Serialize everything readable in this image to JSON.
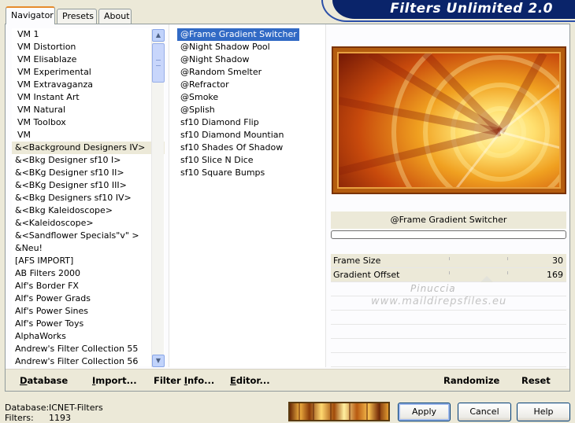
{
  "window": {
    "title": "Filters Unlimited 2.0"
  },
  "tabs": [
    {
      "label": "Navigator",
      "active": true
    },
    {
      "label": "Presets",
      "active": false
    },
    {
      "label": "About",
      "active": false
    }
  ],
  "categories": {
    "items": [
      "VM 1",
      "VM Distortion",
      "VM Elisablaze",
      "VM Experimental",
      "VM Extravaganza",
      "VM Instant Art",
      "VM Natural",
      "VM Toolbox",
      "VM",
      "&<Background Designers IV>",
      "&<Bkg Designer sf10 I>",
      "&<BKg Designer sf10 II>",
      "&<BKg Designer sf10 III>",
      "&<Bkg Designers sf10 IV>",
      "&<Bkg Kaleidoscope>",
      "&<Kaleidoscope>",
      "&<Sandflower Specials\"v\" >",
      "&Neu!",
      "[AFS IMPORT]",
      "AB Filters 2000",
      "Alf's Border FX",
      "Alf's Power Grads",
      "Alf's Power Sines",
      "Alf's Power Toys",
      "AlphaWorks",
      "Andrew's Filter Collection 55",
      "Andrew's Filter Collection 56"
    ],
    "selected_index": 9
  },
  "filters": {
    "items": [
      "@Frame Gradient Switcher",
      "@Night Shadow Pool",
      "@Night Shadow",
      "@Random Smelter",
      "@Refractor",
      "@Smoke",
      "@Splish",
      "sf10 Diamond Flip",
      "sf10 Diamond Mountian",
      "sf10 Shades Of Shadow",
      "sf10 Slice N Dice",
      "sf10 Square Bumps"
    ],
    "selected_index": 0
  },
  "preview": {
    "filter_name": "@Frame Gradient Switcher",
    "progress": 0,
    "frame_color": "#b45c0f",
    "gradient_colors": [
      "#7a1c06",
      "#c84a0c",
      "#f0a020",
      "#ffe070",
      "#fff6b0"
    ]
  },
  "parameters": [
    {
      "label": "Frame Size",
      "value": "30"
    },
    {
      "label": "Gradient Offset",
      "value": "169"
    }
  ],
  "watermark": {
    "line1": "Pinuccia",
    "line2": "www.maildirepsfiles.eu"
  },
  "toolbar": {
    "database": {
      "u": "D",
      "rest": "atabase"
    },
    "import": {
      "u": "I",
      "rest": "mport..."
    },
    "filter_info": {
      "pre": "Filter ",
      "u": "I",
      "rest": "nfo..."
    },
    "editor": {
      "u": "E",
      "rest": "ditor..."
    },
    "randomize": "Randomize",
    "reset": "Reset"
  },
  "status": {
    "database_label": "Database:",
    "database_value": "ICNET-Filters",
    "filters_label": "Filters:",
    "filters_value": "1193"
  },
  "buttons": {
    "apply": "Apply",
    "cancel": "Cancel",
    "help": "Help"
  }
}
